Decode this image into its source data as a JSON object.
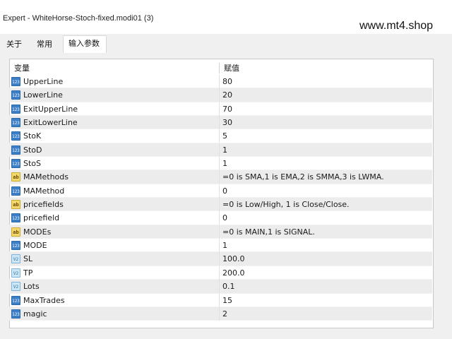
{
  "window": {
    "title": "Expert - WhiteHorse-Stoch-fixed.modi01 (3)"
  },
  "watermark": "www.mt4.shop",
  "tabs": [
    {
      "label": "关于",
      "active": false
    },
    {
      "label": "常用",
      "active": false
    },
    {
      "label": "输入参数",
      "active": true
    }
  ],
  "table": {
    "headers": {
      "variable": "变量",
      "value": "赋值"
    },
    "rows": [
      {
        "icon": "int-icon",
        "icon_text": "123",
        "name": "UpperLine",
        "value": "80"
      },
      {
        "icon": "int-icon",
        "icon_text": "123",
        "name": "LowerLine",
        "value": "20"
      },
      {
        "icon": "int-icon",
        "icon_text": "123",
        "name": "ExitUpperLine",
        "value": "70"
      },
      {
        "icon": "int-icon",
        "icon_text": "123",
        "name": "ExitLowerLine",
        "value": "30"
      },
      {
        "icon": "int-icon",
        "icon_text": "123",
        "name": "StoK",
        "value": "5"
      },
      {
        "icon": "int-icon",
        "icon_text": "123",
        "name": "StoD",
        "value": "1"
      },
      {
        "icon": "int-icon",
        "icon_text": "123",
        "name": "StoS",
        "value": "1"
      },
      {
        "icon": "string-icon",
        "icon_text": "ab",
        "name": "MAMethods",
        "value": "=0 is SMA,1 is EMA,2 is SMMA,3 is LWMA."
      },
      {
        "icon": "int-icon",
        "icon_text": "123",
        "name": "MAMethod",
        "value": "0"
      },
      {
        "icon": "string-icon",
        "icon_text": "ab",
        "name": "pricefields",
        "value": "=0 is Low/High, 1 is Close/Close."
      },
      {
        "icon": "int-icon",
        "icon_text": "123",
        "name": "pricefield",
        "value": "0"
      },
      {
        "icon": "string-icon",
        "icon_text": "ab",
        "name": "MODEs",
        "value": "=0 is MAIN,1 is SIGNAL."
      },
      {
        "icon": "int-icon",
        "icon_text": "123",
        "name": "MODE",
        "value": "1"
      },
      {
        "icon": "double-icon",
        "icon_text": "V2",
        "name": "SL",
        "value": "100.0"
      },
      {
        "icon": "double-icon",
        "icon_text": "V2",
        "name": "TP",
        "value": "200.0"
      },
      {
        "icon": "double-icon",
        "icon_text": "V2",
        "name": "Lots",
        "value": "0.1"
      },
      {
        "icon": "int-icon",
        "icon_text": "123",
        "name": "MaxTrades",
        "value": "15"
      },
      {
        "icon": "int-icon",
        "icon_text": "123",
        "name": "magic",
        "value": "2"
      }
    ]
  }
}
